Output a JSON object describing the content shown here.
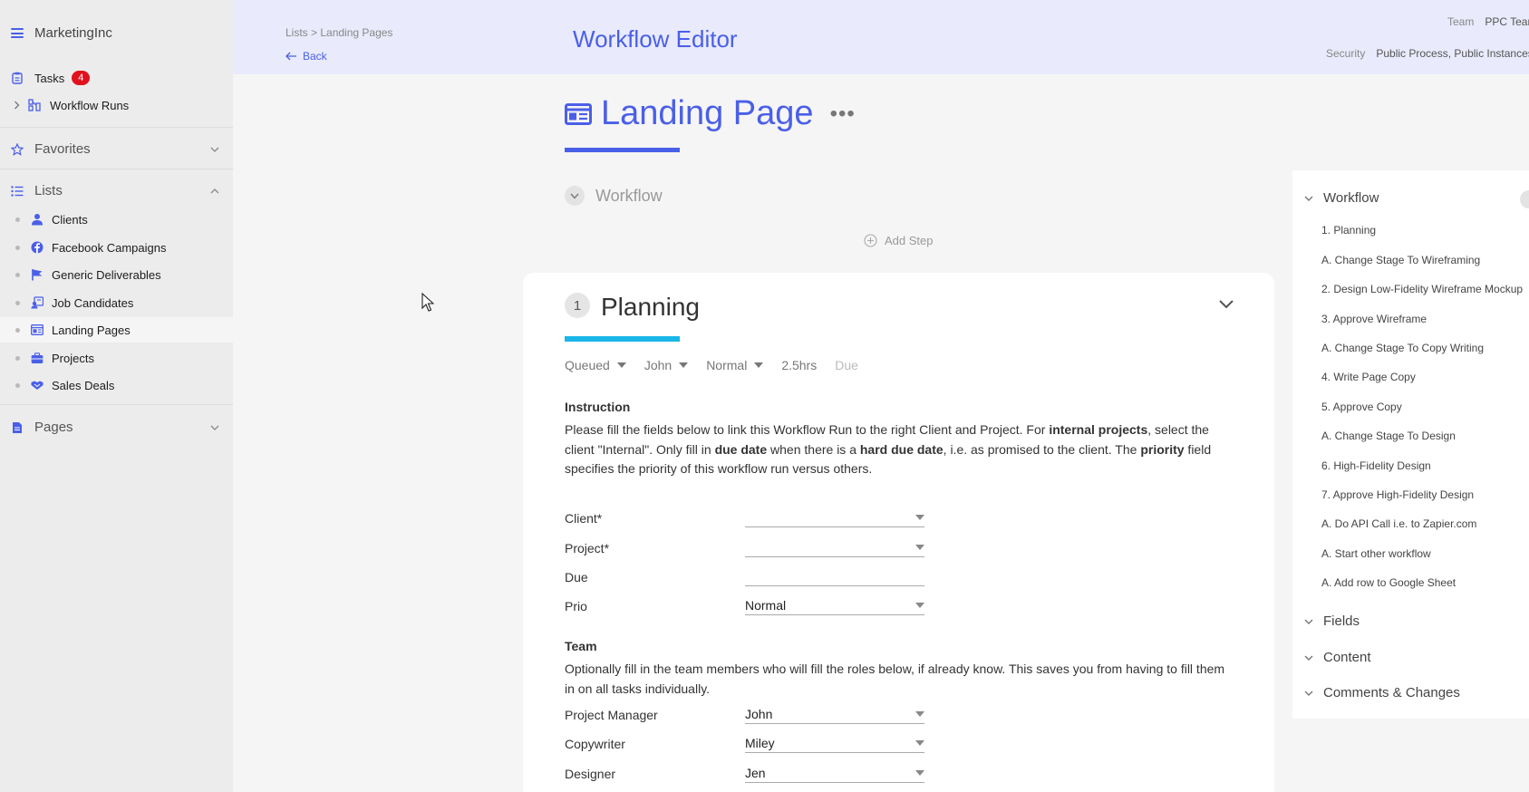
{
  "app": {
    "name": "MarketingInc"
  },
  "sidebar": {
    "tasks": {
      "label": "Tasks",
      "badge": "4"
    },
    "workflow_runs": {
      "label": "Workflow Runs"
    },
    "favorites": {
      "label": "Favorites"
    },
    "lists": {
      "label": "Lists",
      "items": [
        {
          "label": "Clients",
          "icon": "user-tie-icon"
        },
        {
          "label": "Facebook Campaigns",
          "icon": "facebook-icon"
        },
        {
          "label": "Generic Deliverables",
          "icon": "flag-icon"
        },
        {
          "label": "Job Candidates",
          "icon": "id-card-icon"
        },
        {
          "label": "Landing Pages",
          "icon": "layout-icon"
        },
        {
          "label": "Projects",
          "icon": "briefcase-icon"
        },
        {
          "label": "Sales Deals",
          "icon": "handshake-icon"
        }
      ],
      "active_index": 4
    },
    "pages": {
      "label": "Pages"
    }
  },
  "header": {
    "breadcrumb": "Lists > Landing Pages",
    "back_label": "Back",
    "title": "Workflow Editor",
    "team_key": "Team",
    "team_value": "PPC Team",
    "security_key": "Security",
    "security_value": "Public Process, Public Instances"
  },
  "main": {
    "title": "Landing Page",
    "more_label": "•••",
    "workflow_label": "Workflow",
    "add_step_label": "Add Step"
  },
  "step": {
    "number": "1",
    "title": "Planning",
    "status": "Queued",
    "assignee": "John",
    "priority": "Normal",
    "duration": "2.5hrs",
    "due": "Due",
    "instruction_heading": "Instruction",
    "instruction_parts": {
      "p1": "Please fill the fields below to link this Workflow Run to the right Client and Project.  For ",
      "b1": "internal projects",
      "p2": ", select the client \"Internal\". Only fill in ",
      "b2": "due date",
      "p3": " when there is a ",
      "b3": "hard due date",
      "p4": ", i.e. as promised to the client. The ",
      "b4": "priority",
      "p5": " field specifies the priority of this workflow run versus others."
    },
    "fields": [
      {
        "label": "Client*",
        "value": "",
        "dropdown": true
      },
      {
        "label": "Project*",
        "value": "",
        "dropdown": true
      },
      {
        "label": "Due",
        "value": "",
        "dropdown": false
      },
      {
        "label": "Prio",
        "value": "Normal",
        "dropdown": true
      }
    ],
    "team_heading": "Team",
    "team_text": "Optionally fill in the team members who will fill the roles below, if already know. This saves you from having to fill them in on all tasks individually.",
    "roles": [
      {
        "label": "Project Manager",
        "value": "John"
      },
      {
        "label": "Copywriter",
        "value": "Miley"
      },
      {
        "label": "Designer",
        "value": "Jen"
      }
    ]
  },
  "right_panel": {
    "workflow_label": "Workflow",
    "steps": [
      "1. Planning",
      "A. Change Stage To Wireframing",
      "2. Design Low-Fidelity Wireframe Mockup",
      "3. Approve Wireframe",
      "A. Change Stage To Copy Writing",
      "4. Write Page Copy",
      "5. Approve Copy",
      "A. Change Stage To Design",
      "6. High-Fidelity Design",
      "7. Approve High-Fidelity Design",
      "A. Do API Call i.e. to Zapier.com",
      "A. Start other workflow",
      "A. Add row to Google Sheet"
    ],
    "fields_label": "Fields",
    "content_label": "Content",
    "comments_label": "Comments & Changes"
  },
  "colors": {
    "accent": "#4a5fe8",
    "step_bar": "#1ab6e8",
    "badge": "#e2121d"
  }
}
